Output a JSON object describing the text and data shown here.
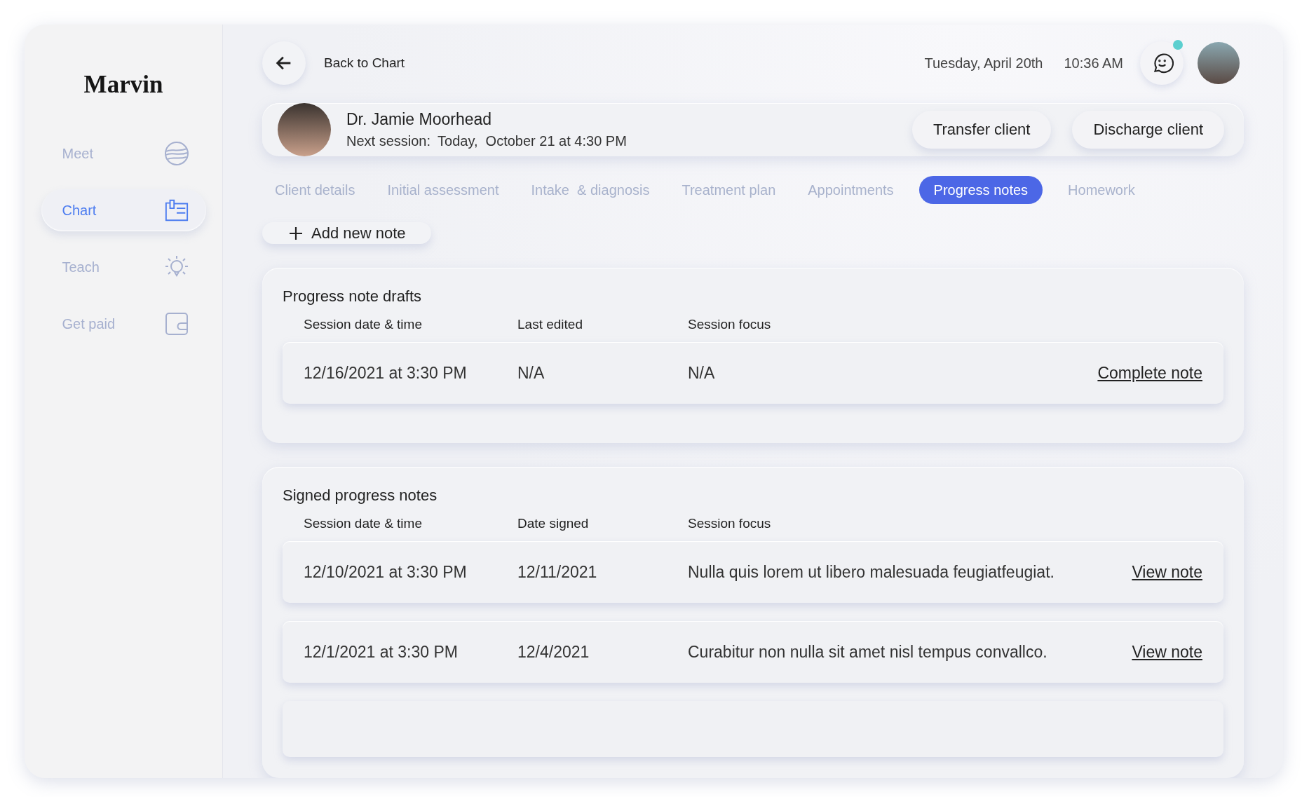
{
  "sidebar": {
    "logo": "Marvin",
    "items": [
      {
        "label": "Meet",
        "kind": "globe",
        "selected": false
      },
      {
        "label": "Chart",
        "kind": "chart",
        "selected": true
      },
      {
        "label": "Teach",
        "kind": "bulb",
        "selected": false
      },
      {
        "label": "Get paid",
        "kind": "wallet",
        "selected": false
      }
    ]
  },
  "topbar": {
    "back_label": "Back to Chart",
    "date": "Tuesday, April 20th",
    "time": "10:36 AM",
    "messages_unread": true
  },
  "client": {
    "name": "Dr. Jamie Moorhead",
    "next_session_label": "Next session:",
    "next_session": "Today,  October 21 at 4:30 PM",
    "actions": [
      "Transfer client",
      "Discharge client"
    ]
  },
  "tabs": [
    {
      "label": "Client details",
      "selected": false
    },
    {
      "label": "Initial assessment",
      "selected": false
    },
    {
      "label": "Intake  & diagnosis",
      "selected": false
    },
    {
      "label": "Treatment plan",
      "selected": false
    },
    {
      "label": "Appointments",
      "selected": false
    },
    {
      "label": "Progress notes",
      "selected": true
    },
    {
      "label": "Homework",
      "selected": false
    }
  ],
  "add_button": "Add new note",
  "sections": [
    {
      "title": "Progress note drafts",
      "columns": [
        "Session date & time",
        "Last edited",
        "Session focus"
      ],
      "rows": [
        {
          "cells": [
            "12/16/2021 at 3:30 PM",
            "N/A",
            "N/A"
          ],
          "action": "Complete note"
        }
      ]
    },
    {
      "title": "Signed progress notes",
      "columns": [
        "Session date & time",
        "Date signed",
        "Session focus"
      ],
      "rows": [
        {
          "cells": [
            "12/10/2021 at 3:30 PM",
            "12/11/2021",
            "Nulla quis lorem ut libero malesuada feugiatfeugiat."
          ],
          "action": "View note"
        },
        {
          "cells": [
            "12/1/2021 at 3:30 PM",
            "12/4/2021",
            "Curabitur non nulla sit amet nisl tempus convallco."
          ],
          "action": "View note"
        }
      ],
      "more_rows": true
    }
  ]
}
